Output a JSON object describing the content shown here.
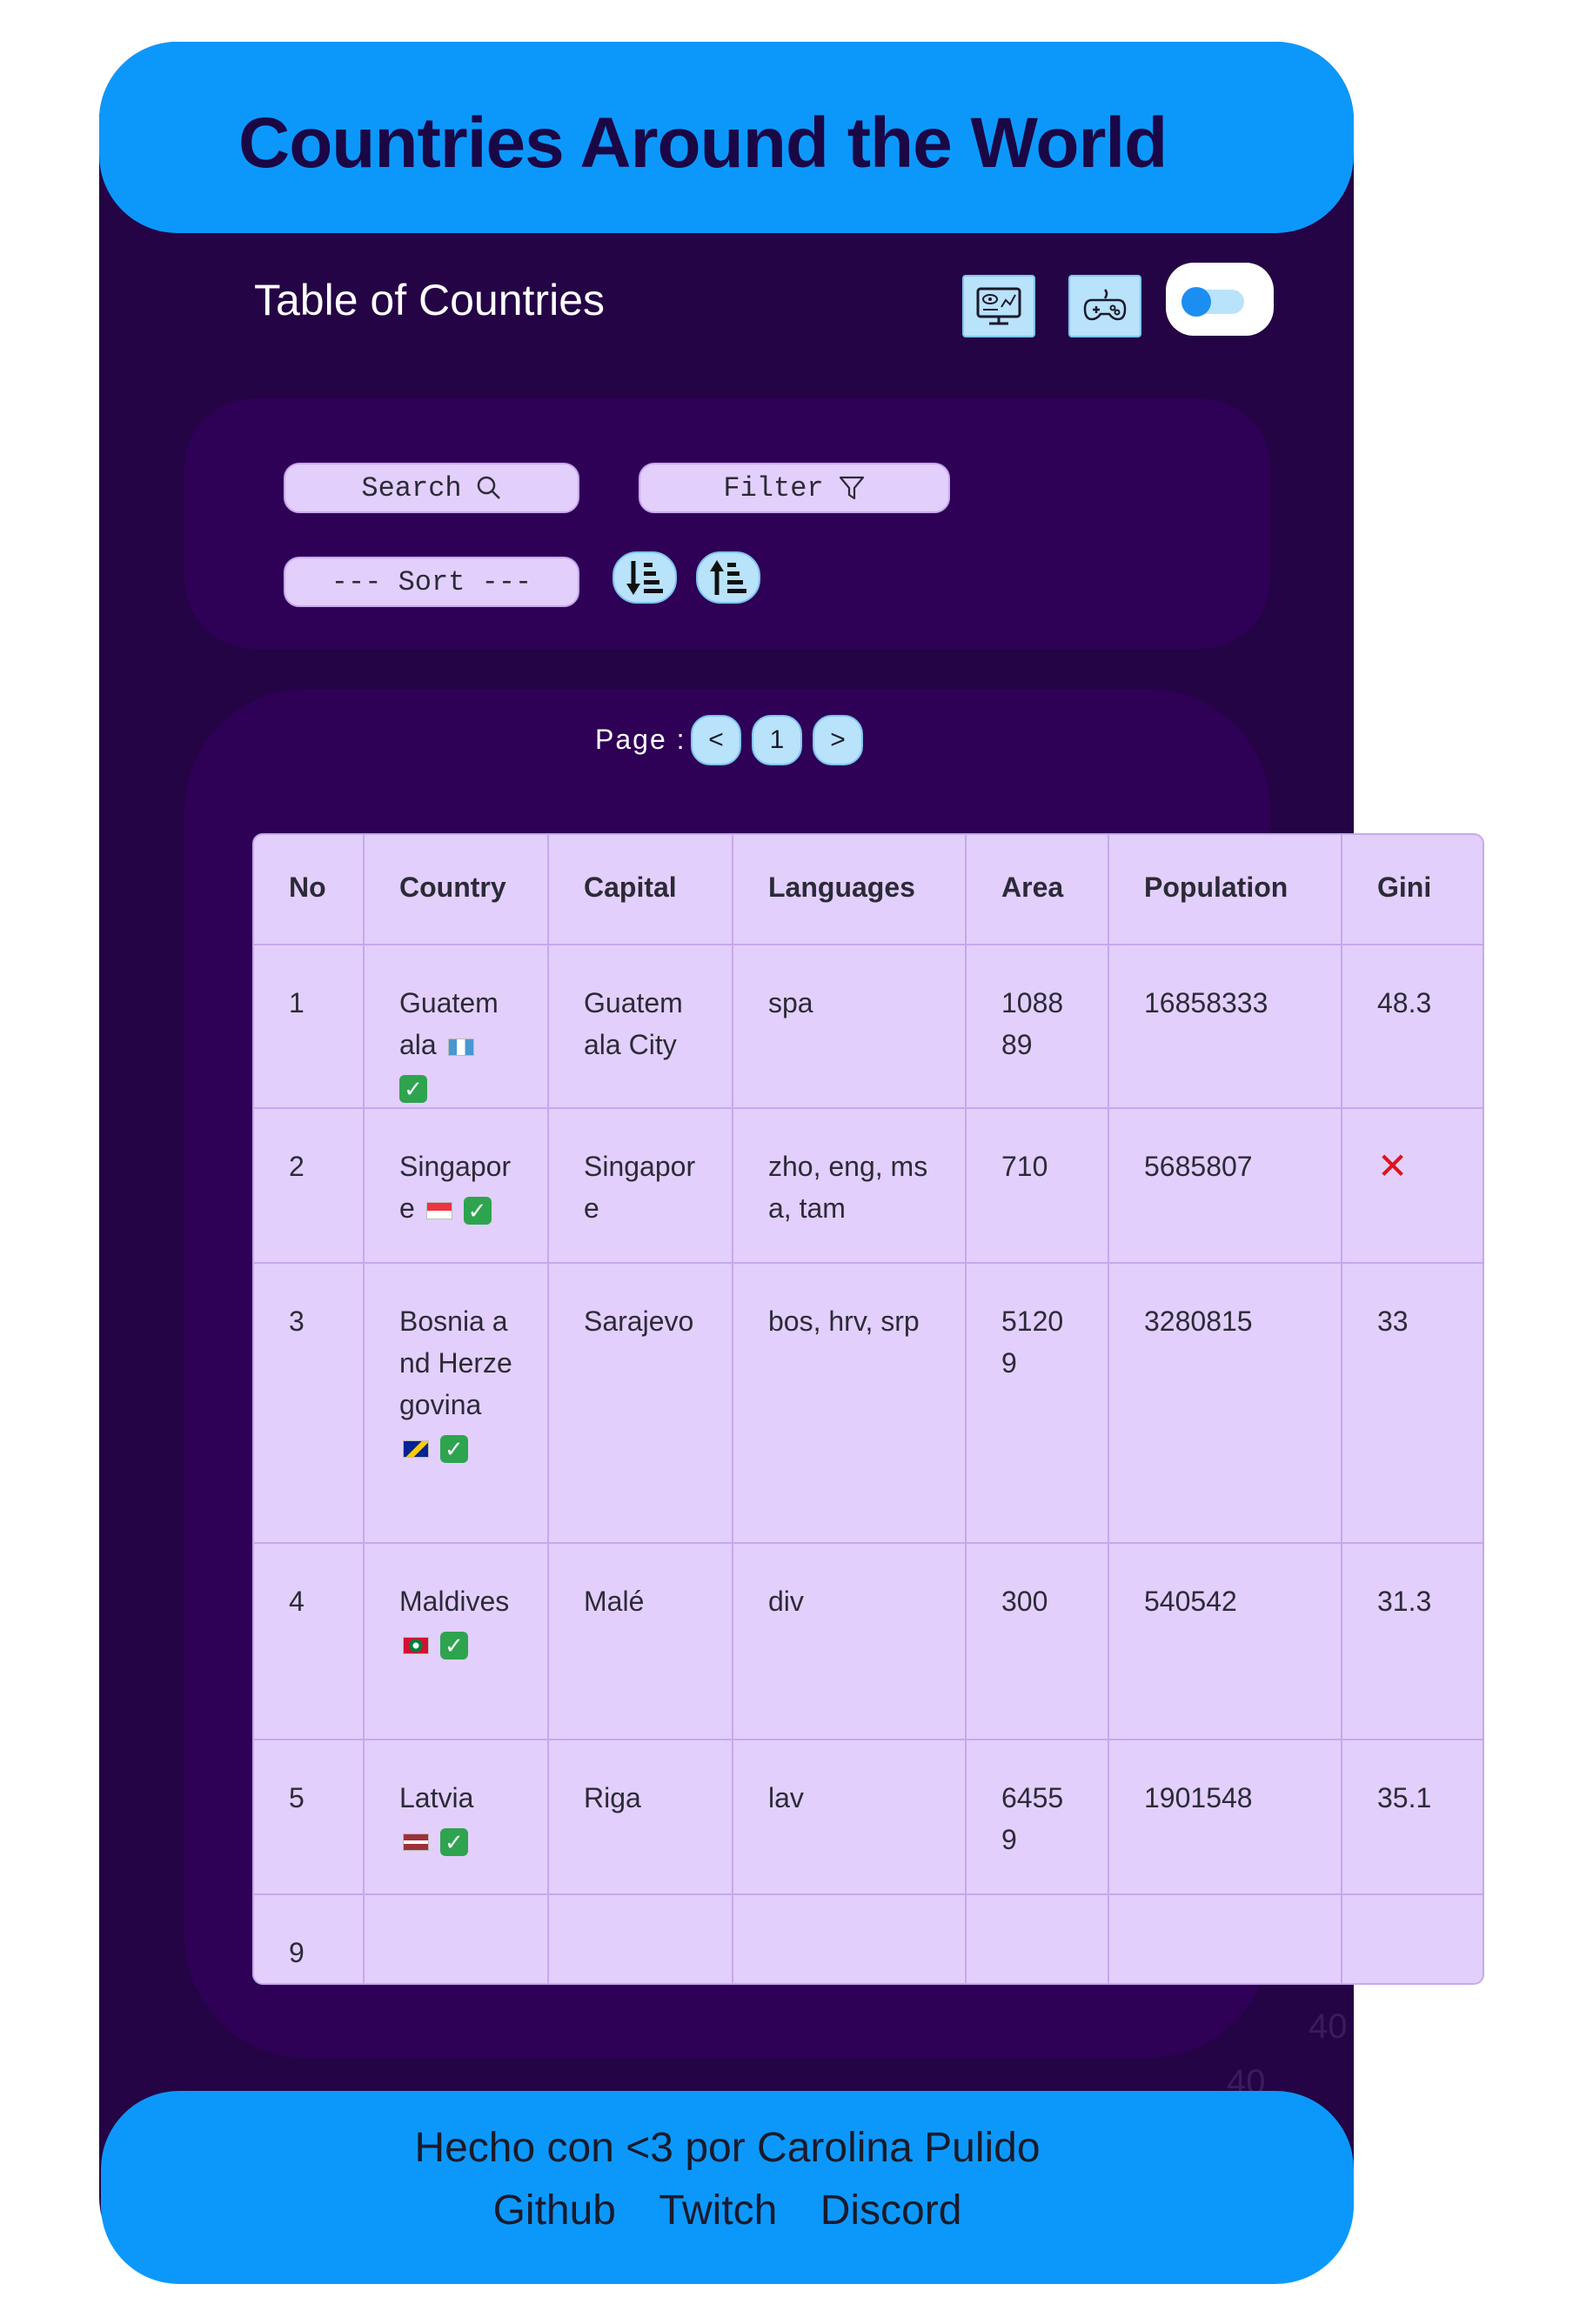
{
  "header": {
    "title": "Countries Around the World"
  },
  "toolbar": {
    "subtitle": "Table of Countries",
    "toggle_on": true
  },
  "controls": {
    "search_label": "Search",
    "filter_label": "Filter",
    "sort_label": "--- Sort ---"
  },
  "pagination": {
    "label": "Page :",
    "prev": "<",
    "current": "1",
    "next": ">"
  },
  "table": {
    "headers": [
      "No",
      "Country",
      "Capital",
      "Languages",
      "Area",
      "Population",
      "Gini"
    ],
    "rows": [
      {
        "no": "1",
        "country": "Guatemala",
        "capital": "Guatemala City",
        "languages": "spa",
        "area": "108889",
        "population": "16858333",
        "gini": "48.3"
      },
      {
        "no": "2",
        "country": "Singapore",
        "capital": "Singapore",
        "languages": "zho, eng, msa, tam",
        "area": "710",
        "population": "5685807",
        "gini": ""
      },
      {
        "no": "3",
        "country": "Bosnia and Herzegovina",
        "capital": "Sarajevo",
        "languages": "bos, hrv, srp",
        "area": "51209",
        "population": "3280815",
        "gini": "33"
      },
      {
        "no": "4",
        "country": "Maldives",
        "capital": "Malé",
        "languages": "div",
        "area": "300",
        "population": "540542",
        "gini": "31.3"
      },
      {
        "no": "5",
        "country": "Latvia",
        "capital": "Riga",
        "languages": "lav",
        "area": "64559",
        "population": "1901548",
        "gini": "35.1"
      },
      {
        "no": "9",
        "country": "",
        "capital": "",
        "languages": "",
        "area": "",
        "population": "",
        "gini": ""
      }
    ],
    "missing_gini_mark": "✕",
    "check_mark": "✓"
  },
  "ghost_text": [
    "40",
    "40"
  ],
  "footer": {
    "credit": "Hecho con <3 por Carolina Pulido",
    "links": [
      "Github",
      "Twitch",
      "Discord"
    ]
  },
  "colors": {
    "header_bg": "#0c98fb",
    "app_bg": "#240445",
    "panel_bg": "#2e0056",
    "table_bg": "#e3cffb",
    "button_bg": "#b9e2fb"
  }
}
